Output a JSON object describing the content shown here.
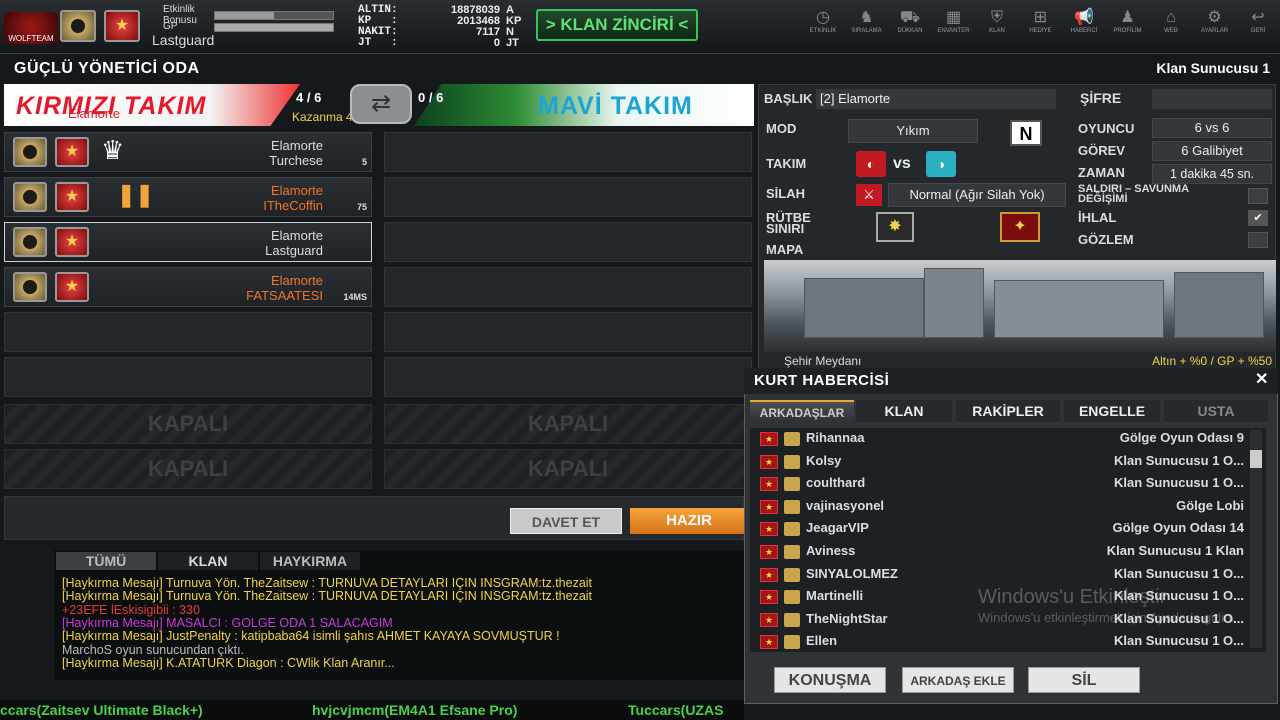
{
  "topbar": {
    "logo_text": "WOLFTEAM",
    "bonus_label": "Etkinlik Bonusu",
    "gp_label": "GP",
    "player_name": "Lastguard",
    "stats": [
      {
        "label": "ALTIN:",
        "value": "18878039",
        "unit": "A"
      },
      {
        "label": "KP   :",
        "value": "2013468",
        "unit": "KP"
      },
      {
        "label": "NAKIT:",
        "value": "7117",
        "unit": "N"
      },
      {
        "label": "JT   :",
        "value": "0",
        "unit": "JT"
      }
    ],
    "klan_button": "> KLAN ZİNCİRİ <",
    "nav": [
      {
        "label": "ETKİNLİK",
        "icon": "clock-icon",
        "glyph": "◷"
      },
      {
        "label": "SIRALAMA",
        "icon": "wolf-icon",
        "glyph": "♞"
      },
      {
        "label": "DÜKKAN",
        "icon": "cart-icon",
        "glyph": "⛟"
      },
      {
        "label": "ENVANTER",
        "icon": "inventory-icon",
        "glyph": "▦"
      },
      {
        "label": "KLAN",
        "icon": "shield-icon",
        "glyph": "⛨"
      },
      {
        "label": "HEDİYE",
        "icon": "gift-icon",
        "glyph": "⊞"
      },
      {
        "label": "HABERCİ",
        "icon": "megaphone-icon",
        "glyph": "📢"
      },
      {
        "label": "PROFİLİM",
        "icon": "user-icon",
        "glyph": "♟"
      },
      {
        "label": "WEB",
        "icon": "web-icon",
        "glyph": "⌂"
      },
      {
        "label": "AYARLAR",
        "icon": "gear-icon",
        "glyph": "⚙"
      },
      {
        "label": "GERİ",
        "icon": "back-icon",
        "glyph": "↩"
      }
    ]
  },
  "room": {
    "title": "GÜÇLÜ YÖNETİCİ ODA",
    "host": "Klan Sunucusu 1",
    "red_team": "KIRMIZI TAKIM",
    "red_score": "4 / 6",
    "red_clan": "Elamorte",
    "win_rate": "Kazanma 45%",
    "blue_team": "MAVİ TAKIM",
    "blue_score": "0 / 6"
  },
  "players": [
    {
      "clan": "Elamorte",
      "name": "Turchese",
      "ping": "5",
      "status": "crown",
      "color": "#dddddd"
    },
    {
      "clan": "Elamorte",
      "name": "ITheCoffin",
      "ping": "75",
      "status": "pause",
      "color": "#f0742a"
    },
    {
      "clan": "Elamorte",
      "name": "Lastguard",
      "ping": "",
      "status": "",
      "color": "#dddddd"
    },
    {
      "clan": "Elamorte",
      "name": "FATSAATESI",
      "ping": "14MS",
      "status": "",
      "color": "#f0742a"
    }
  ],
  "closed_label": "KAPALI",
  "settings": {
    "title_label": "BAŞLIK",
    "title_value": "[2] Elamorte",
    "password_label": "ŞİFRE",
    "mode_label": "MOD",
    "mode_value": "Yıkım",
    "mode_badge": "N",
    "team_label": "TAKIM",
    "vs": "vs",
    "weapon_label": "SİLAH",
    "weapon_value": "Normal (Ağır Silah Yok)",
    "rank_label": "RÜTBE SINIRI",
    "map_label": "MAPA",
    "player_label": "OYUNCU",
    "player_value": "6 vs 6",
    "mission_label": "GÖREV",
    "mission_value": "6 Galibiyet",
    "time_label": "ZAMAN",
    "time_value": "1 dakika 45 sn.",
    "swap_label": "SALDIRI – SAVUNMA DEĞİŞİMİ",
    "ihlal_label": "İHLAL",
    "gozlem_label": "GÖZLEM",
    "map_name": "Şehir Meydanı",
    "map_bonus": "Altın + %0 / GP + %50"
  },
  "buttons": {
    "invite": "DAVET ET",
    "ready": "HAZIR"
  },
  "chat": {
    "tabs": [
      "TÜMÜ",
      "KLAN",
      "HAYKIRMA"
    ],
    "lines": [
      {
        "text": "[Haykırma Mesajı] Turnuva Yön. TheZaitsew : TURNUVA DETAYLARI İÇİN İNSGRAM:tz.thezait",
        "color": "#f2d24a"
      },
      {
        "text": "[Haykırma Mesajı] Turnuva Yön. TheZaitsew : TURNUVA DETAYLARI İÇİN İNSGRAM:tz.thezait",
        "color": "#f2d24a"
      },
      {
        "text": "   +23EFE lEskisigibii : 330",
        "color": "#e33a3a"
      },
      {
        "text": "[Haykırma Mesajı] MASALCI : GÖLGE ODA 1 SALACAĞIM",
        "color": "#c93ad6"
      },
      {
        "text": "[Haykırma Mesajı] JustPenalty : katipbaba64 isimli şahıs AHMET KAYAYA SÖVMÜŞTÜR !",
        "color": "#f2d24a"
      },
      {
        "text": "MarchoS oyun sunucundan çıktı.",
        "color": "#bbbbbb"
      },
      {
        "text": "[Haykırma Mesajı] K.ATATURK Diagon : CWlik Klan Aranır...",
        "color": "#f2d24a"
      }
    ]
  },
  "kurt": {
    "title": "KURT HABERCİSİ",
    "tabs": [
      "ARKADAŞLAR",
      "KLAN",
      "RAKİPLER",
      "ENGELLE",
      "USTA"
    ],
    "friends": [
      {
        "name": "Rihannaa",
        "location": "Gölge Oyun Odası 9"
      },
      {
        "name": "Kolsy",
        "location": "Klan Sunucusu 1 O..."
      },
      {
        "name": "coulthard",
        "location": "Klan Sunucusu 1 O..."
      },
      {
        "name": "vajinasyonel",
        "location": "Gölge Lobi"
      },
      {
        "name": "JeagarVIP",
        "location": "Gölge Oyun Odası 14"
      },
      {
        "name": "Aviness",
        "location": "Klan Sunucusu 1 Klan"
      },
      {
        "name": "SINYALOLMEZ",
        "location": "Klan Sunucusu 1 O..."
      },
      {
        "name": "Martinelli",
        "location": "Klan Sunucusu 1 O..."
      },
      {
        "name": "TheNightStar",
        "location": "Klan Sunucusu 1 O..."
      },
      {
        "name": "Ellen",
        "location": "Klan Sunucusu 1 O..."
      }
    ],
    "buttons": [
      "KONUŞMA",
      "ARKADAŞ EKLE",
      "SİL"
    ]
  },
  "watermark": {
    "line1": "Windows'u Etkinleştir",
    "line2": "Windows'u etkinleştirmek için Ayarlar'a gidin."
  },
  "ticker": [
    "ccars(Zaitsev Ultimate Black+)",
    "hvjcvjmcm(EM4A1 Efsane Pro)",
    "Tuccars(UZAS"
  ]
}
